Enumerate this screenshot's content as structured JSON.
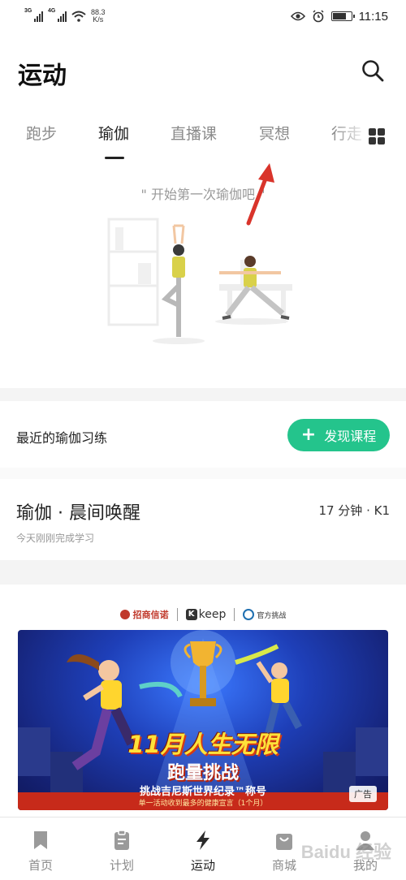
{
  "status_bar": {
    "net1": "3G",
    "net2": "4G",
    "speed_value": "88.3",
    "speed_unit": "K/s",
    "time": "11:15"
  },
  "header": {
    "title": "运动",
    "search_icon": "search-icon"
  },
  "tabs": [
    {
      "label": "跑步",
      "active": false
    },
    {
      "label": "瑜伽",
      "active": true
    },
    {
      "label": "直播课",
      "active": false
    },
    {
      "label": "冥想",
      "active": false
    },
    {
      "label": "行走",
      "active": false
    }
  ],
  "hero": {
    "caption": "\" 开始第一次瑜伽吧 \""
  },
  "recent": {
    "title": "最近的瑜伽习练",
    "button_label": "发现课程"
  },
  "session": {
    "title": "瑜伽 · 晨间唤醒",
    "meta": "17 分钟 · K1",
    "status": "今天刚刚完成学习"
  },
  "ad": {
    "logo1": "招商信诺",
    "logo2": "keep",
    "logo3": "官方挑战",
    "headline": "11月人生无限",
    "subhead": "跑量挑战",
    "line3": "挑战吉尼斯世界纪录™称号",
    "line4": "单一活动收到最多的健康宣言（1个月）",
    "badge": "广告"
  },
  "bottom_nav": [
    {
      "label": "首页",
      "icon": "bookmark-icon",
      "active": false
    },
    {
      "label": "计划",
      "icon": "clipboard-icon",
      "active": false
    },
    {
      "label": "运动",
      "icon": "lightning-icon",
      "active": true
    },
    {
      "label": "商城",
      "icon": "shopping-bag-icon",
      "active": false
    },
    {
      "label": "我的",
      "icon": "profile-icon",
      "active": false
    }
  ],
  "watermark": "Baidu 经验",
  "colors": {
    "accent": "#24c48c",
    "arrow": "#d9342b"
  }
}
